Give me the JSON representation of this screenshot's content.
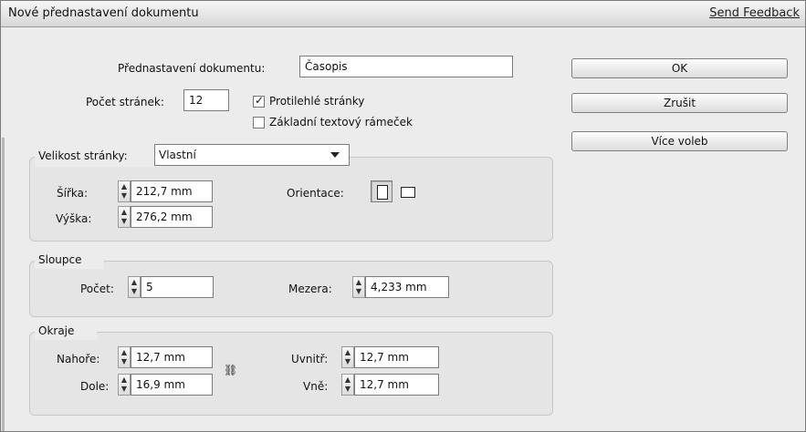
{
  "title": "Nové přednastavení dokumentu",
  "send_feedback": "Send Feedback",
  "preset": {
    "label": "Přednastavení dokumentu:",
    "value": "Časopis"
  },
  "pages": {
    "label": "Počet stránek:",
    "value": "12",
    "facing_pages_label": "Protilehlé stránky",
    "facing_pages_checked": true,
    "primary_text_frame_label": "Základní textový rámeček",
    "primary_text_frame_checked": false
  },
  "buttons": {
    "ok": "OK",
    "cancel": "Zrušit",
    "more_options": "Více voleb"
  },
  "page_size": {
    "label": "Velikost stránky:",
    "value": "Vlastní",
    "width_label": "Šířka:",
    "width_value": "212,7 mm",
    "height_label": "Výška:",
    "height_value": "276,2 mm",
    "orientation_label": "Orientace:",
    "orientation_selected": "portrait"
  },
  "columns": {
    "legend": "Sloupce",
    "count_label": "Počet:",
    "count_value": "5",
    "gutter_label": "Mezera:",
    "gutter_value": "4,233 mm"
  },
  "margins": {
    "legend": "Okraje",
    "top_label": "Nahoře:",
    "top_value": "12,7 mm",
    "bottom_label": "Dole:",
    "bottom_value": "16,9 mm",
    "inside_label": "Uvnitř:",
    "inside_value": "12,7 mm",
    "outside_label": "Vně:",
    "outside_value": "12,7 mm"
  },
  "icons": {
    "checkbox": "check-icon",
    "spinner": "spinner-icon",
    "orientation_portrait": "portrait-orientation-icon",
    "orientation_landscape": "landscape-orientation-icon",
    "chain": "chain-link-icon"
  }
}
